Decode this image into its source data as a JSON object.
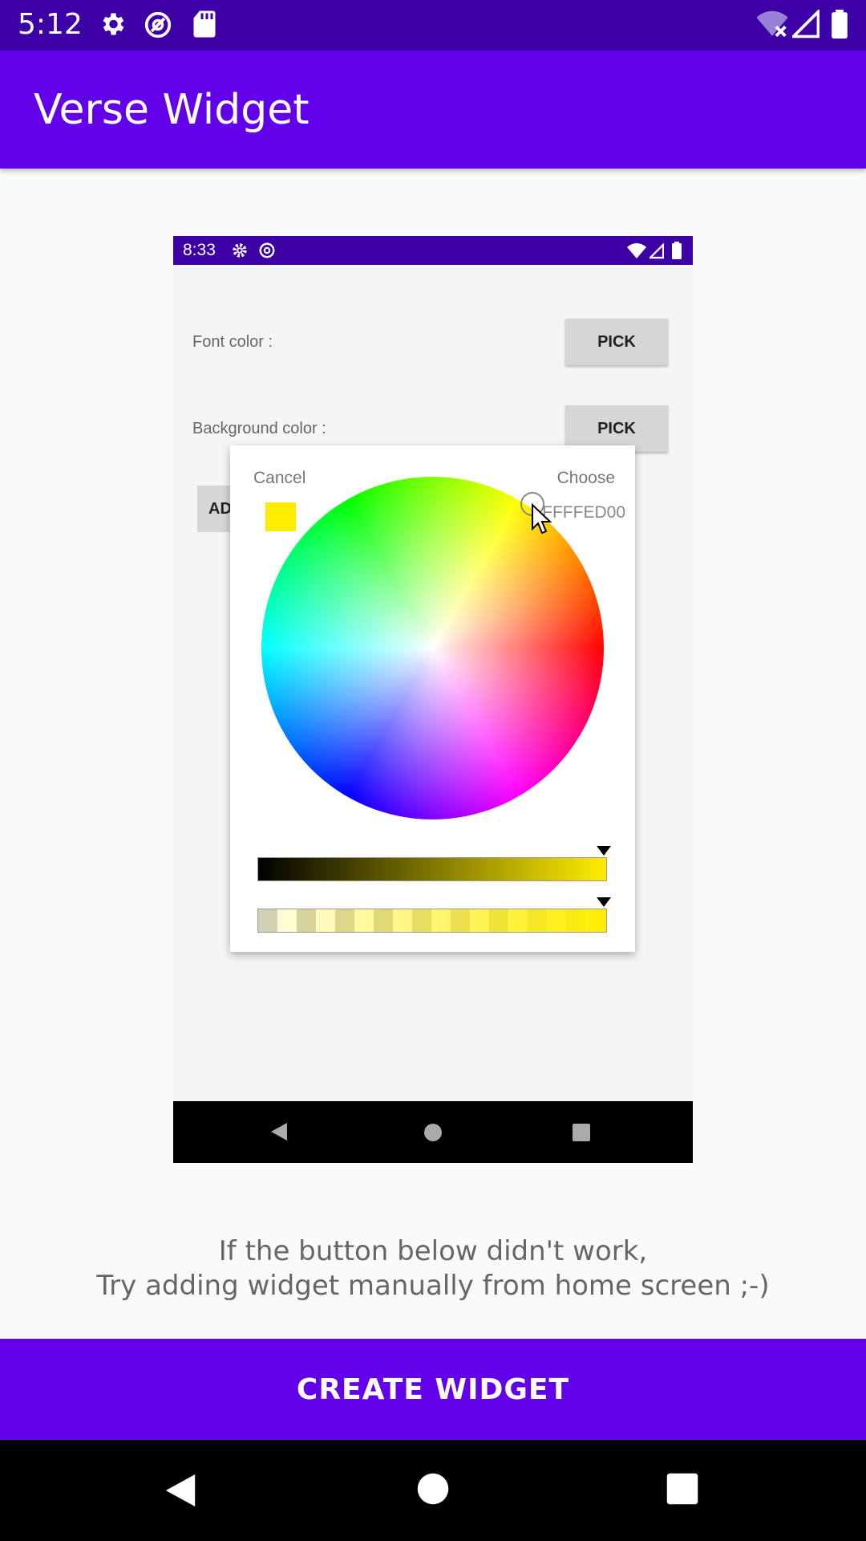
{
  "status_bar": {
    "time": "5:12",
    "icons": [
      "gear-icon",
      "at-sign-icon",
      "sd-card-icon",
      "wifi-off-icon",
      "signal-icon",
      "battery-icon"
    ]
  },
  "app_bar": {
    "title": "Verse Widget"
  },
  "preview": {
    "status_time": "8:33",
    "font_color_label": "Font color :",
    "background_color_label": "Background color :",
    "pick_label": "PICK",
    "add_label": "AD",
    "dialog": {
      "cancel": "Cancel",
      "choose": "Choose",
      "hex_value": "FFFFED00",
      "selected_color": "#ffed00",
      "brightness_level": 1.0,
      "alpha_level": 1.0
    }
  },
  "hint": {
    "line1": "If the button below didn't work,",
    "line2": "Try adding widget manually from home screen  ;-)"
  },
  "create_button": {
    "label": "CREATE WIDGET"
  },
  "colors": {
    "primary": "#6200ea",
    "status_bar": "#3d00a5"
  }
}
